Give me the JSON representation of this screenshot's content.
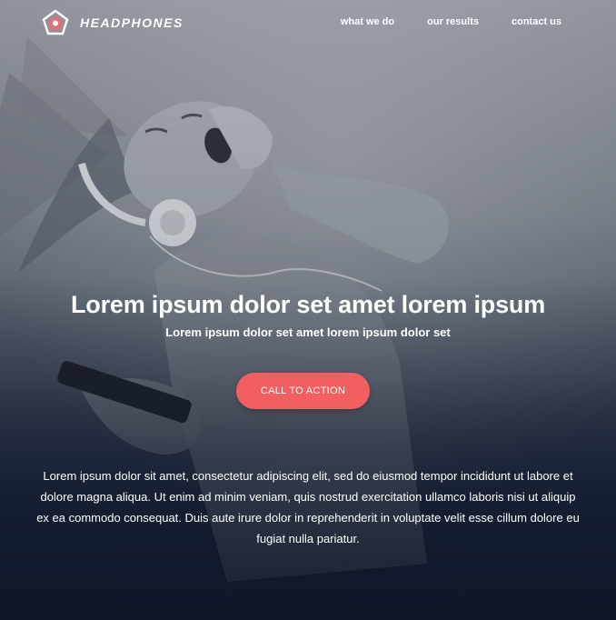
{
  "brand": {
    "name": "HEADPHONES"
  },
  "nav": {
    "links": [
      {
        "label": "what we do"
      },
      {
        "label": "our results"
      },
      {
        "label": "contact us"
      }
    ]
  },
  "hero": {
    "headline": "Lorem ipsum dolor set amet lorem ipsum",
    "subheadline": "Lorem ipsum dolor set amet lorem ipsum dolor set",
    "cta_label": "CALL TO ACTION",
    "body": "Lorem ipsum dolor sit amet, consectetur adipiscing elit, sed do eiusmod tempor incididunt ut labore et dolore magna aliqua. Ut enim ad minim veniam, quis nostrud exercitation ullamco laboris nisi ut aliquip ex ea commodo consequat. Duis aute irure dolor in reprehenderit in voluptate velit esse cillum dolore eu fugiat nulla pariatur."
  },
  "colors": {
    "accent": "#f25f60",
    "logo_mark": "#e0707a",
    "overlay_dark": "#121b2e"
  },
  "icons": {
    "logo": "pentagon-logo-icon"
  }
}
